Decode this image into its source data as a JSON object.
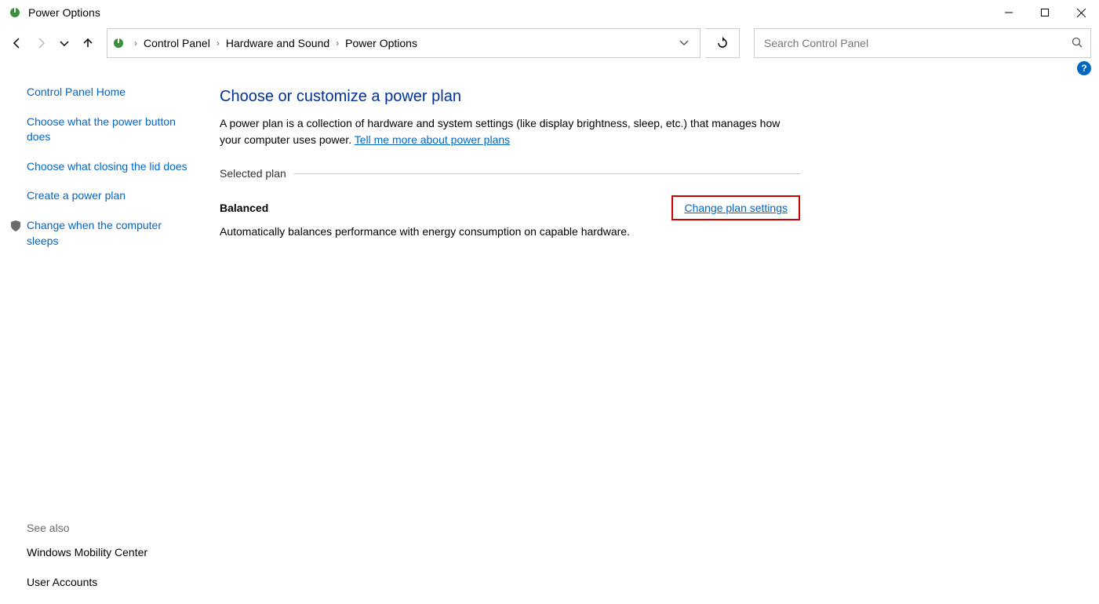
{
  "window": {
    "title": "Power Options"
  },
  "breadcrumb": {
    "items": [
      "Control Panel",
      "Hardware and Sound",
      "Power Options"
    ]
  },
  "search": {
    "placeholder": "Search Control Panel"
  },
  "sidebar": {
    "links": [
      "Control Panel Home",
      "Choose what the power button does",
      "Choose what closing the lid does",
      "Create a power plan",
      "Change when the computer sleeps"
    ],
    "see_also_title": "See also",
    "see_also": [
      "Windows Mobility Center",
      "User Accounts"
    ]
  },
  "main": {
    "title": "Choose or customize a power plan",
    "description_pre": "A power plan is a collection of hardware and system settings (like display brightness, sleep, etc.) that manages how your computer uses power. ",
    "description_link": "Tell me more about power plans",
    "section_label": "Selected plan",
    "plan_name": "Balanced",
    "change_link": "Change plan settings",
    "plan_desc": "Automatically balances performance with energy consumption on capable hardware."
  },
  "help": {
    "label": "?"
  }
}
